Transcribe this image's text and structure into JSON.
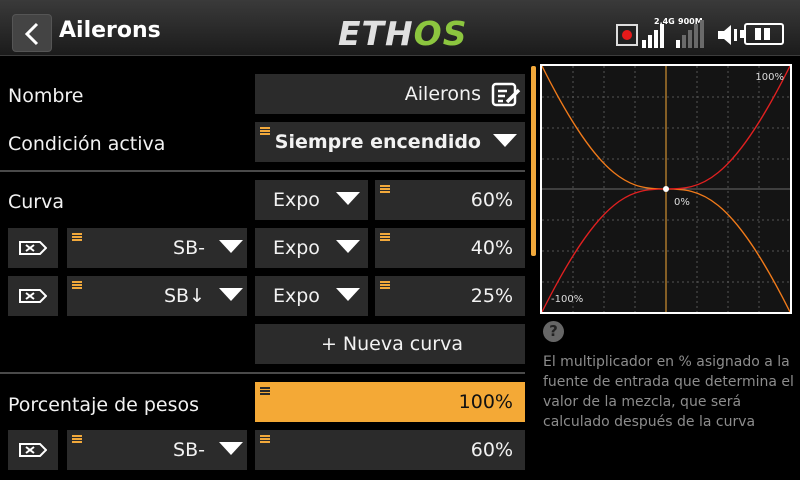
{
  "header": {
    "title": "Ailerons",
    "logo_main": "ETH",
    "logo_accent": "OS",
    "signal_label_1": "2.4G",
    "signal_label_2": "900M"
  },
  "form": {
    "name_label": "Nombre",
    "name_value": "Ailerons",
    "condition_label": "Condición activa",
    "condition_value": "Siempre encendido",
    "curve_label": "Curva",
    "curve_rows": [
      {
        "curve_type": "Expo",
        "value": "60%"
      },
      {
        "switch": "SB-",
        "curve_type": "Expo",
        "value": "40%"
      },
      {
        "switch": "SB↓",
        "curve_type": "Expo",
        "value": "25%"
      }
    ],
    "new_curve_label": "+ Nueva curva",
    "weight_label": "Porcentaje de pesos",
    "weight_value": "100%",
    "weight_rows": [
      {
        "switch": "SB-",
        "value": "60%"
      }
    ]
  },
  "graph": {
    "top_label": "100%",
    "center_label": "0%",
    "bottom_label": "-100%"
  },
  "help": {
    "icon": "?",
    "text": "El multiplicador en % asignado a la fuente de entrada que determina el valor de la mezcla, que será calculado después de la curva"
  },
  "colors": {
    "accent": "#f4a936",
    "logo_green": "#8cc63f",
    "curve_red": "#e02020",
    "curve_orange": "#f07a1a"
  }
}
